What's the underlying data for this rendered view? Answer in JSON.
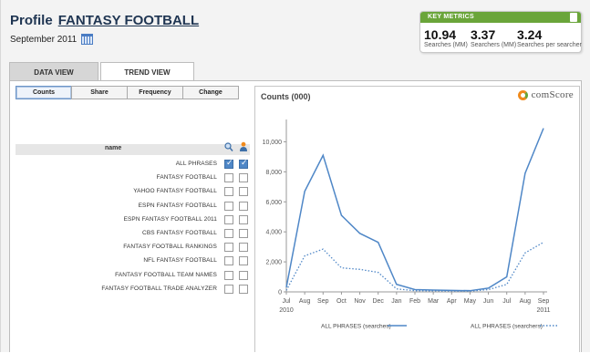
{
  "header": {
    "title": "Profile",
    "entity": "FANTASY FOOTBALL",
    "date": "September 2011"
  },
  "key_metrics": {
    "label": "KEY METRICS",
    "items": [
      {
        "value": "10.94",
        "label": "Searches (MM)"
      },
      {
        "value": "3.37",
        "label": "Searchers (MM)"
      },
      {
        "value": "3.24",
        "label": "Searches per searcher"
      }
    ]
  },
  "tabs": [
    {
      "label": "DATA VIEW",
      "active": false
    },
    {
      "label": "TREND VIEW",
      "active": true
    }
  ],
  "segments": [
    {
      "label": "Counts",
      "active": true
    },
    {
      "label": "Share",
      "active": false
    },
    {
      "label": "Frequency",
      "active": false
    },
    {
      "label": "Change",
      "active": false
    }
  ],
  "list": {
    "column_name": "name",
    "icons": [
      "search-icon",
      "user-icon"
    ],
    "rows": [
      {
        "label": "ALL PHRASES",
        "checked_search": true,
        "checked_user": true
      },
      {
        "label": "FANTASY FOOTBALL",
        "checked_search": false,
        "checked_user": false
      },
      {
        "label": "YAHOO FANTASY FOOTBALL",
        "checked_search": false,
        "checked_user": false
      },
      {
        "label": "ESPN FANTASY FOOTBALL",
        "checked_search": false,
        "checked_user": false
      },
      {
        "label": "ESPN FANTASY FOOTBALL 2011",
        "checked_search": false,
        "checked_user": false
      },
      {
        "label": "CBS FANTASY FOOTBALL",
        "checked_search": false,
        "checked_user": false
      },
      {
        "label": "FANTASY FOOTBALL RANKINGS",
        "checked_search": false,
        "checked_user": false
      },
      {
        "label": "NFL FANTASY FOOTBALL",
        "checked_search": false,
        "checked_user": false
      },
      {
        "label": "FANTASY FOOTBALL TEAM NAMES",
        "checked_search": false,
        "checked_user": false
      },
      {
        "label": "FANTASY FOOTBALL TRADE ANALYZER",
        "checked_search": false,
        "checked_user": false
      }
    ]
  },
  "chart": {
    "title": "Counts (000)",
    "brand": "comScore",
    "accent": "#4f87c7"
  },
  "chart_data": {
    "type": "line",
    "title": "Counts (000)",
    "x": [
      "Jul",
      "Aug",
      "Sep",
      "Oct",
      "Nov",
      "Dec",
      "Jan",
      "Feb",
      "Mar",
      "Apr",
      "May",
      "Jun",
      "Jul",
      "Aug",
      "Sep"
    ],
    "x_year_labels": [
      {
        "index": 0,
        "text": "2010"
      },
      {
        "index": 14,
        "text": "2011"
      }
    ],
    "yticks": [
      "0",
      "2,000",
      "4,000",
      "6,000",
      "8,000",
      "10,000"
    ],
    "ylim": [
      0,
      11000
    ],
    "series": [
      {
        "name": "ALL PHRASES (searches)",
        "style": "solid",
        "values": [
          300,
          6700,
          9100,
          5100,
          3900,
          3300,
          500,
          150,
          120,
          100,
          80,
          250,
          1000,
          7900,
          10900
        ]
      },
      {
        "name": "ALL PHRASES (searchers)",
        "style": "dotted",
        "values": [
          100,
          2400,
          2850,
          1600,
          1500,
          1300,
          200,
          80,
          70,
          60,
          50,
          150,
          500,
          2600,
          3300
        ]
      }
    ],
    "legend_position": "bottom"
  }
}
